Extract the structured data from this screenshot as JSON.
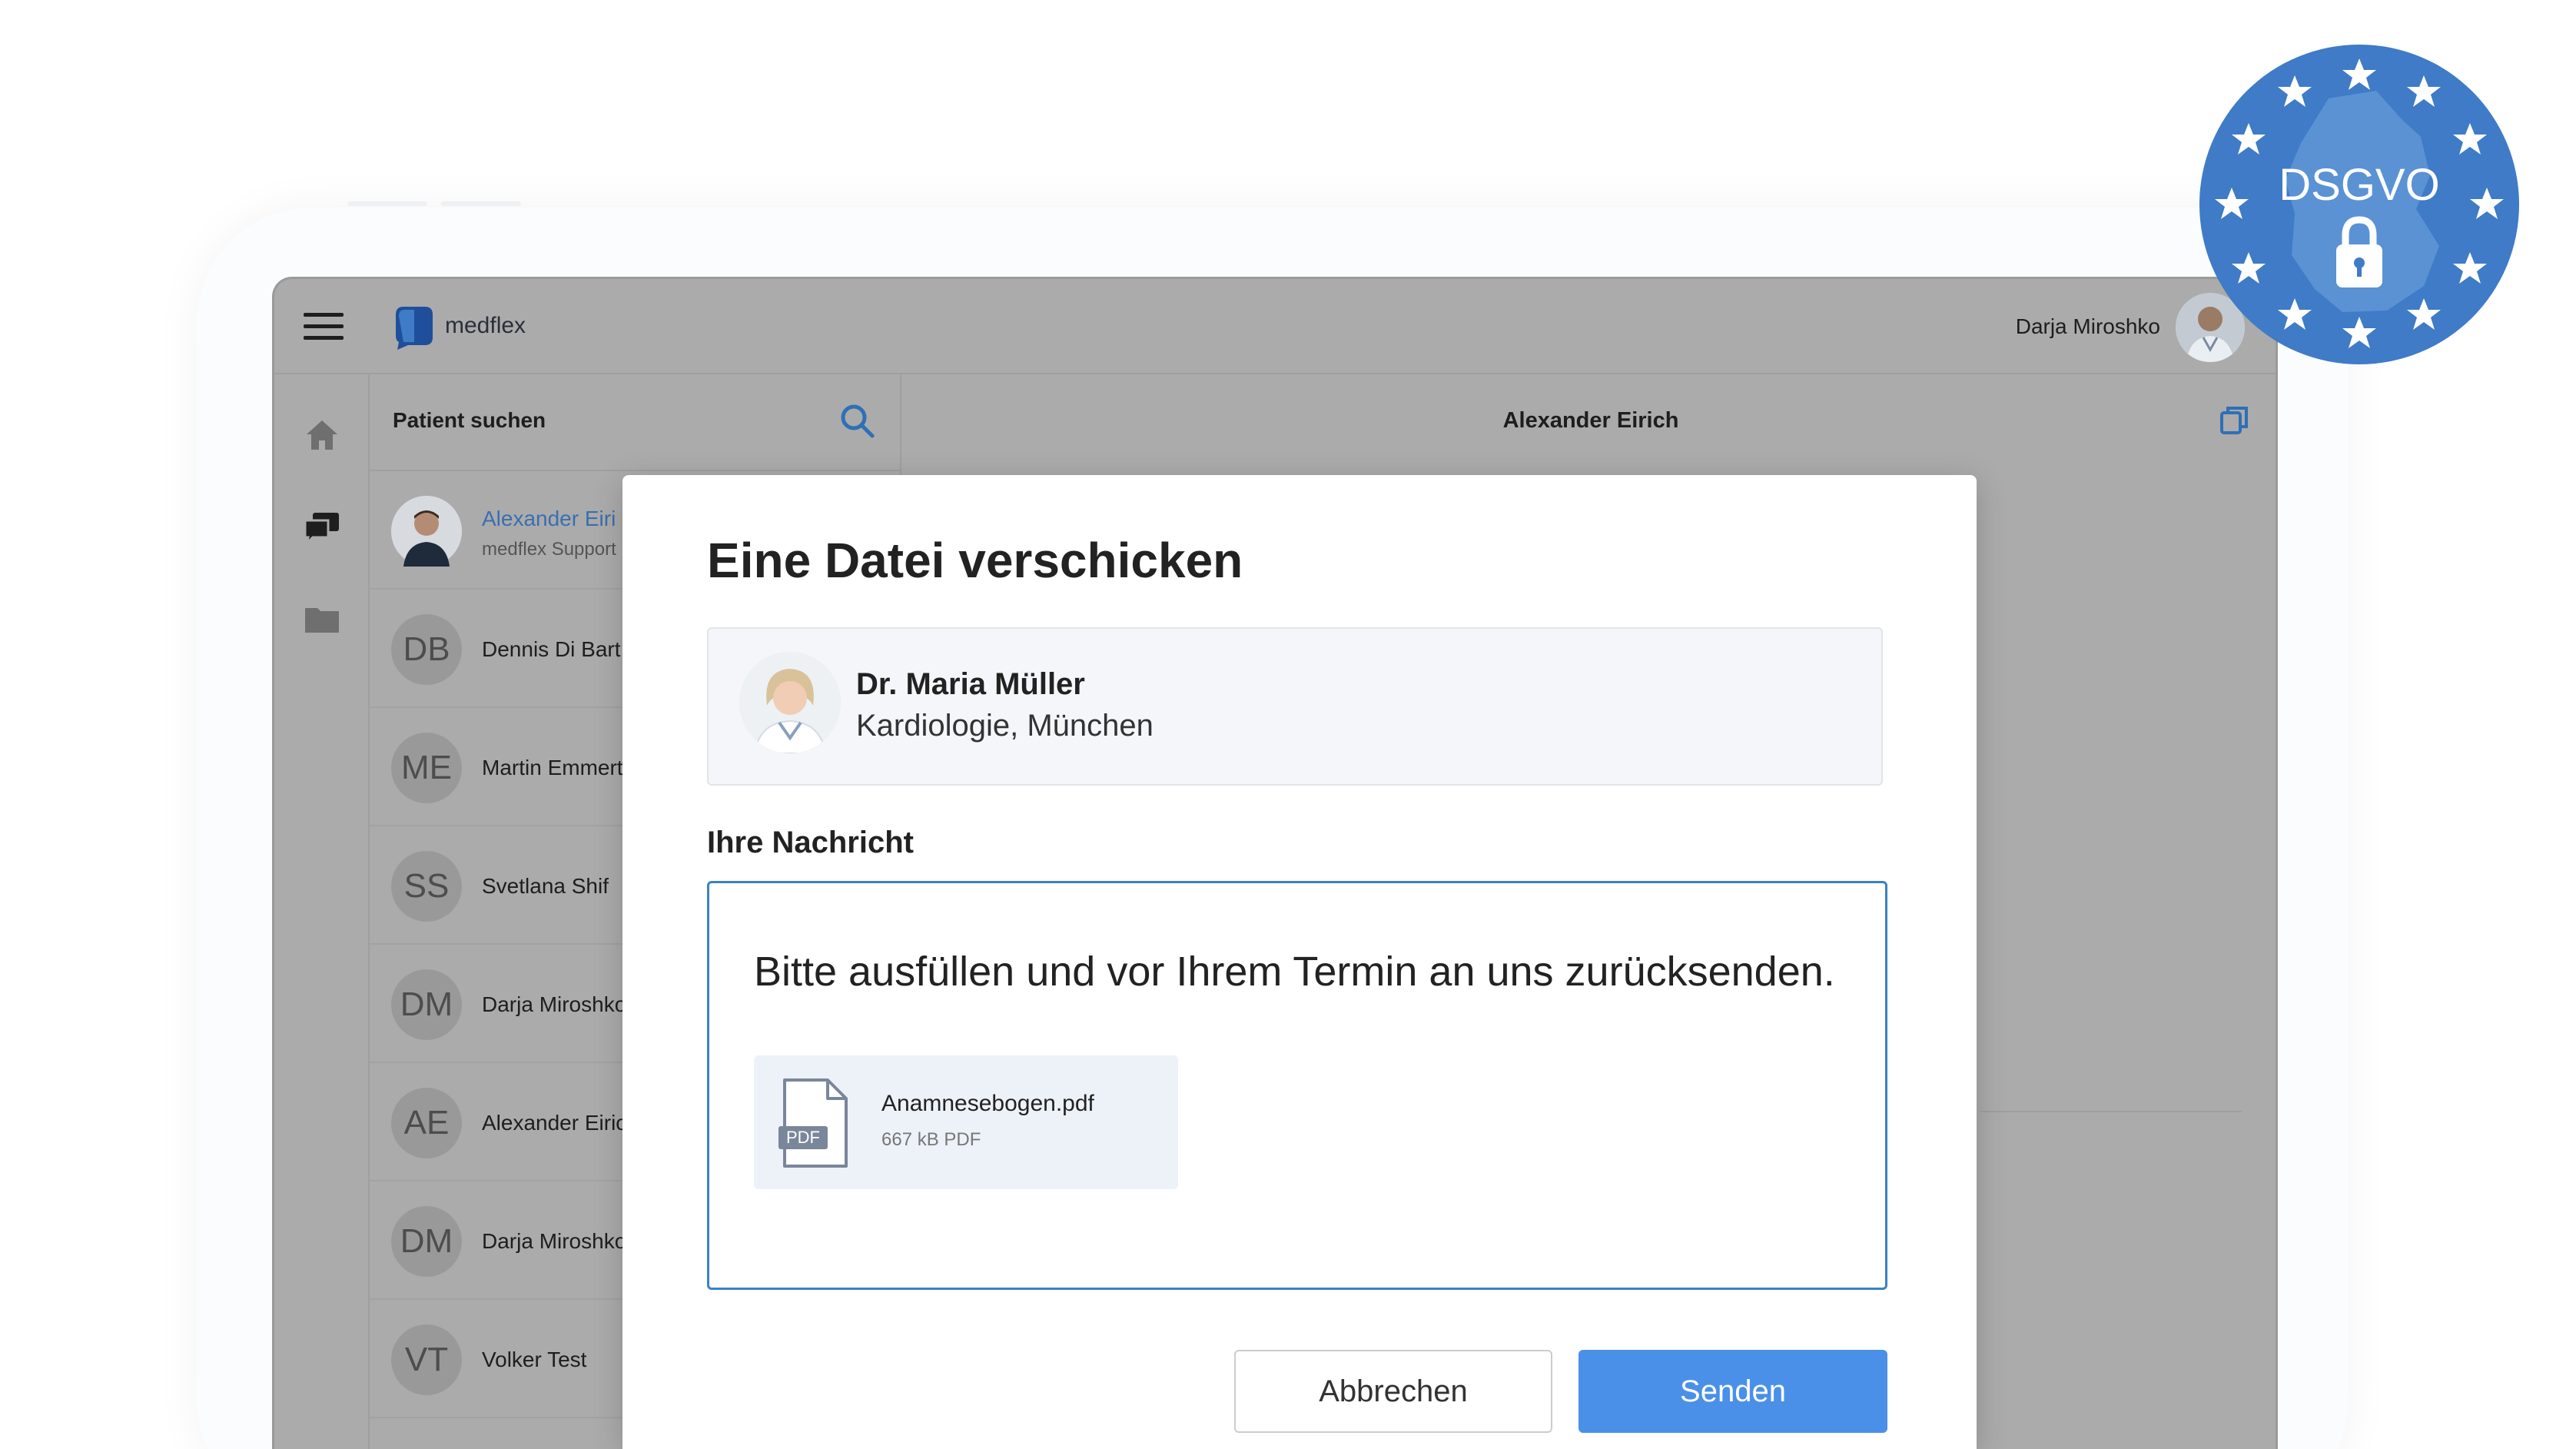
{
  "app": {
    "brand": "medflex",
    "user_name": "Darja Miroshko"
  },
  "sidebar": {
    "search_label": "Patient suchen",
    "contacts": [
      {
        "initials": "",
        "name": "Alexander Eiri",
        "subtitle": "medflex Support",
        "photo": true
      },
      {
        "initials": "DB",
        "name": "Dennis Di Bart"
      },
      {
        "initials": "ME",
        "name": "Martin Emmert"
      },
      {
        "initials": "SS",
        "name": "Svetlana Shif"
      },
      {
        "initials": "DM",
        "name": "Darja Miroshko"
      },
      {
        "initials": "AE",
        "name": "Alexander Eiric"
      },
      {
        "initials": "DM",
        "name": "Darja Miroshko"
      },
      {
        "initials": "VT",
        "name": "Volker Test"
      }
    ]
  },
  "chat": {
    "title": "Alexander Eirich"
  },
  "modal": {
    "title": "Eine Datei verschicken",
    "recipient": {
      "name": "Dr. Maria Müller",
      "department": "Kardiologie, München"
    },
    "message_label": "Ihre Nachricht",
    "message_text": "Bitte ausfüllen und vor Ihrem Termin an uns zurücksenden.",
    "attachment": {
      "filename": "Anamnesebogen.pdf",
      "meta": "667 kB PDF",
      "badge": "PDF"
    },
    "cancel_label": "Abbrechen",
    "send_label": "Senden"
  },
  "badge": {
    "text": "DSGVO"
  },
  "colors": {
    "accent": "#4a90e8",
    "link_blue": "#3a6fb0",
    "eu_blue": "#3f7bc7",
    "overlay_gray": "#ababab"
  }
}
